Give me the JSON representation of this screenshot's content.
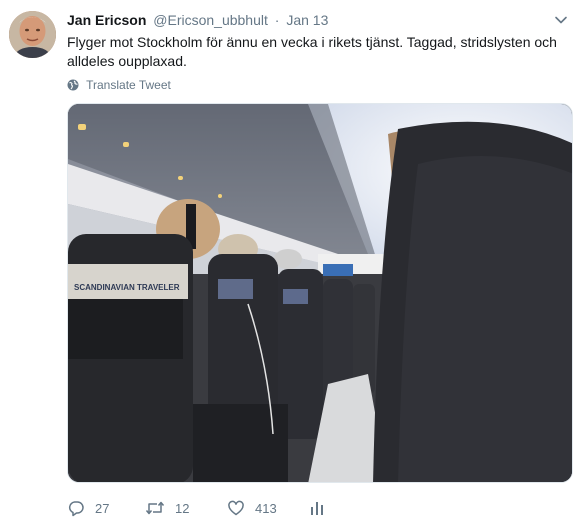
{
  "tweet": {
    "author_name": "Jan Ericson",
    "handle": "@Ericson_ubbhult",
    "separator": "·",
    "date": "Jan 13",
    "text": "Flyger mot Stockholm för ännu en vecka i rikets tjänst. Taggad, stridslysten och alldeles oupplaxad.",
    "translate_label": "Translate Tweet",
    "media": {
      "seat_pocket_card_text": "SCANDINAVIAN TRAVELER"
    }
  },
  "actions": {
    "reply_count": "27",
    "retweet_count": "12",
    "like_count": "413"
  },
  "icons": {
    "more": "chevron-down-icon",
    "translate": "globe-icon",
    "reply": "reply-icon",
    "retweet": "retweet-icon",
    "like": "heart-icon",
    "analytics": "analytics-icon"
  },
  "colors": {
    "text_primary": "#14171a",
    "text_secondary": "#657786",
    "border": "#e1e8ed"
  }
}
